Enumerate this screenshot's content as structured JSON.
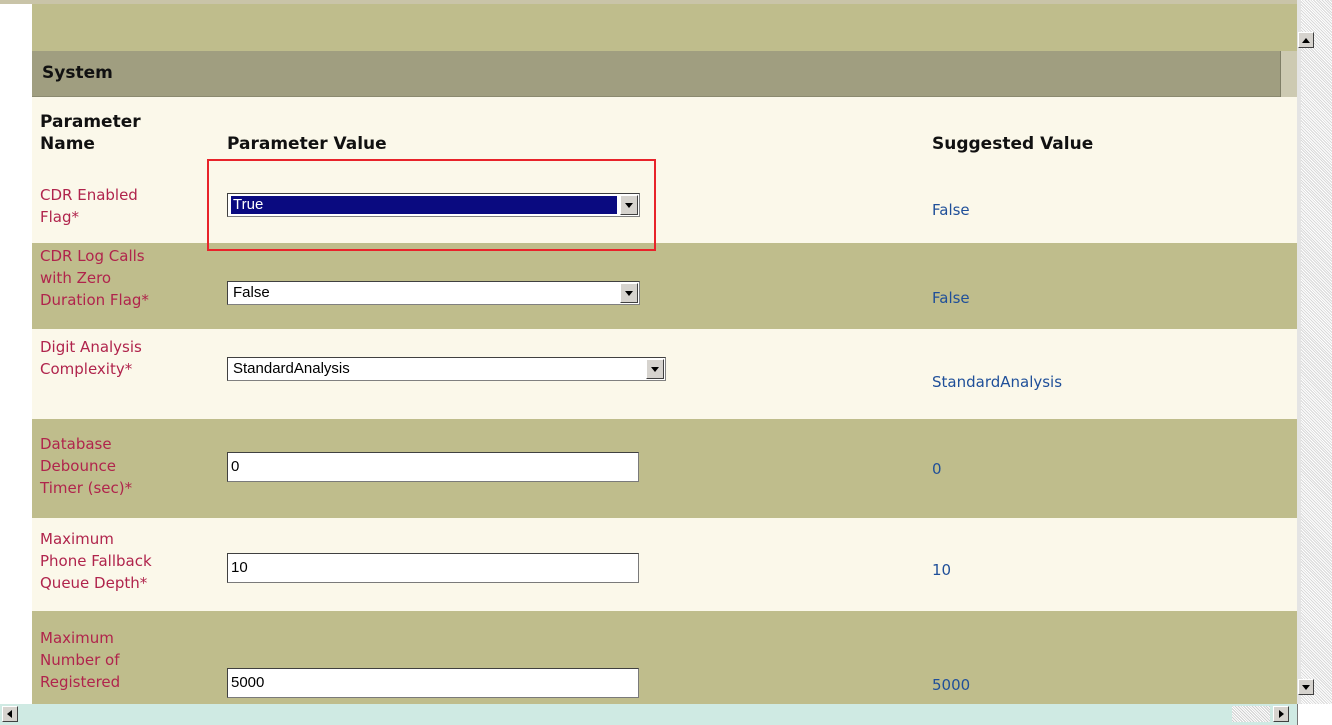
{
  "section": {
    "title": "System"
  },
  "columns": {
    "name": "Parameter\nName",
    "value": "Parameter Value",
    "suggested": "Suggested Value"
  },
  "rows": [
    {
      "name": "CDR Enabled\nFlag*",
      "control": "select",
      "value": "True",
      "suggested": "False",
      "focused": true
    },
    {
      "name": "CDR Log Calls\nwith Zero\nDuration Flag*",
      "control": "select",
      "value": "False",
      "suggested": "False"
    },
    {
      "name": "Digit Analysis\nComplexity*",
      "control": "select",
      "value": "StandardAnalysis",
      "suggested": "StandardAnalysis"
    },
    {
      "name": "Database\nDebounce\nTimer (sec)*",
      "control": "text",
      "value": "0",
      "suggested": "0"
    },
    {
      "name": "Maximum\nPhone Fallback\nQueue Depth*",
      "control": "text",
      "value": "10",
      "suggested": "10"
    },
    {
      "name": "Maximum\nNumber of\nRegistered",
      "control": "text",
      "value": "5000",
      "suggested": "5000"
    }
  ],
  "colors": {
    "section_header": "#a09e80",
    "row_shade": "#bfbd8c",
    "row_light": "#fbf8ea",
    "param_name": "#b0244c",
    "suggested_value": "#1f4f99",
    "highlight": "#e8232a"
  },
  "icons": {
    "dropdown": "chevron-down-icon",
    "scroll_up": "arrow-up-icon",
    "scroll_down": "arrow-down-icon",
    "scroll_left": "arrow-left-icon",
    "scroll_right": "arrow-right-icon"
  }
}
